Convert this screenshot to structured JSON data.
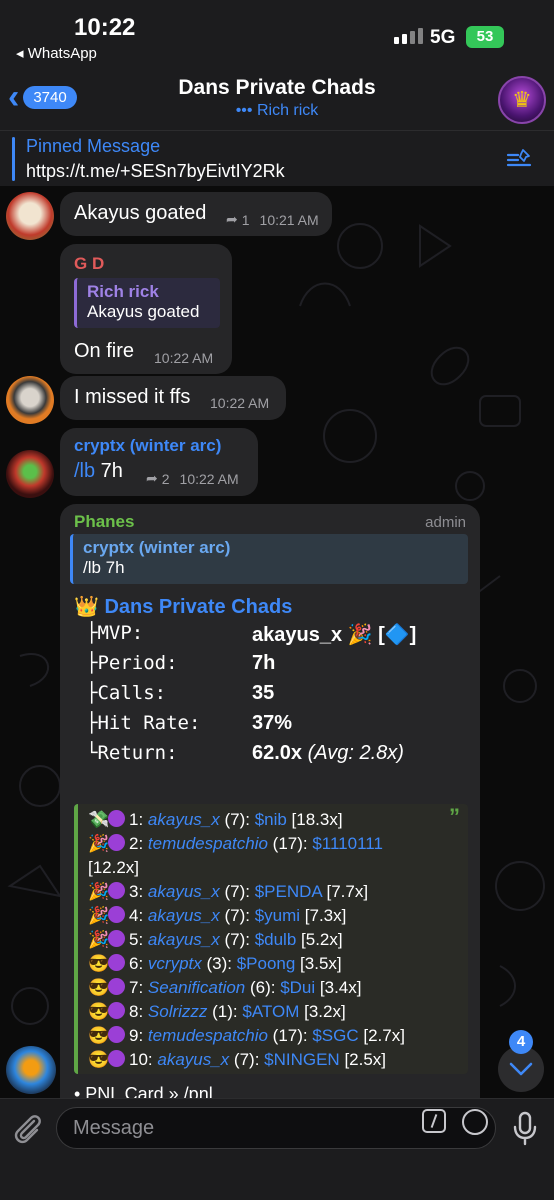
{
  "status_bar": {
    "time": "10:22",
    "back_app": "◂ WhatsApp",
    "network": "5G",
    "battery": "53"
  },
  "header": {
    "back_count": "3740",
    "title": "Dans Private Chads",
    "typing": "••• Rich rick"
  },
  "pinned": {
    "label": "Pinned Message",
    "link": "https://t.me/+SESn7byEivtIY2Rk"
  },
  "messages": [
    {
      "text": "Akayus goated",
      "replies": "1",
      "time": "10:21 AM"
    },
    {
      "sender": "G D",
      "sender_color": "#e05a5a",
      "reply_name": "Rich rick",
      "reply_text": "Akayus goated",
      "text": "On fire",
      "time": "10:22 AM"
    },
    {
      "text": "I missed it ffs",
      "time": "10:22 AM"
    },
    {
      "sender": "cryptx (winter arc)",
      "sender_color": "#3e88f7",
      "command": "/lb",
      "arg": " 7h",
      "replies": "2",
      "time": "10:22 AM"
    }
  ],
  "phanes": {
    "sender": "Phanes",
    "sender_color": "#6cc04a",
    "role": "admin",
    "reply_name": "cryptx (winter arc)",
    "reply_text": "/lb 7h",
    "title_emoji": "👑",
    "title": "Dans Private Chads",
    "stats": [
      {
        "key": "├MVP:",
        "value": "akayus_x 🎉 [🔷]"
      },
      {
        "key": "├Period:",
        "value": "7h"
      },
      {
        "key": "├Calls:",
        "value": "35"
      },
      {
        "key": "├Hit Rate:",
        "value": "37%"
      },
      {
        "key": "└Return:",
        "value": "62.0x",
        "extra": "(Avg: 2.8x)"
      }
    ],
    "leaderboard": [
      {
        "emoji": "💸",
        "rank": "1:",
        "user": "akayus_x",
        "calls": "(7):",
        "token": "$nib",
        "mult": "[18.3x]"
      },
      {
        "emoji": "🎉",
        "rank": "2:",
        "user": "temudespatchio",
        "calls": "(17):",
        "token": "$1110111",
        "mult": "[12.2x]"
      },
      {
        "emoji": "🎉",
        "rank": "3:",
        "user": "akayus_x",
        "calls": "(7):",
        "token": "$PENDA",
        "mult": "[7.7x]"
      },
      {
        "emoji": "🎉",
        "rank": "4:",
        "user": "akayus_x",
        "calls": "(7):",
        "token": "$yumi",
        "mult": "[7.3x]"
      },
      {
        "emoji": "🎉",
        "rank": "5:",
        "user": "akayus_x",
        "calls": "(7):",
        "token": "$dulb",
        "mult": "[5.2x]"
      },
      {
        "emoji": "😎",
        "rank": "6:",
        "user": "vcryptx",
        "calls": "(3):",
        "token": "$Poong",
        "mult": "[3.5x]"
      },
      {
        "emoji": "😎",
        "rank": "7:",
        "user": "Seanification",
        "calls": "(6):",
        "token": "$Dui",
        "mult": "[3.4x]"
      },
      {
        "emoji": "😎",
        "rank": "8:",
        "user": "Solrizzz",
        "calls": "(1):",
        "token": "$ATOM",
        "mult": "[3.2x]"
      },
      {
        "emoji": "😎",
        "rank": "9:",
        "user": "temudespatchio",
        "calls": "(17):",
        "token": "$SGC",
        "mult": "[2.7x]"
      },
      {
        "emoji": "😎",
        "rank": "10:",
        "user": "akayus_x",
        "calls": "(7):",
        "token": "$NINGEN",
        "mult": "[2.5x]"
      }
    ],
    "footer_partial": "• PNL Card » /pnl"
  },
  "scroll_badge": "4",
  "input": {
    "placeholder": "Message"
  }
}
